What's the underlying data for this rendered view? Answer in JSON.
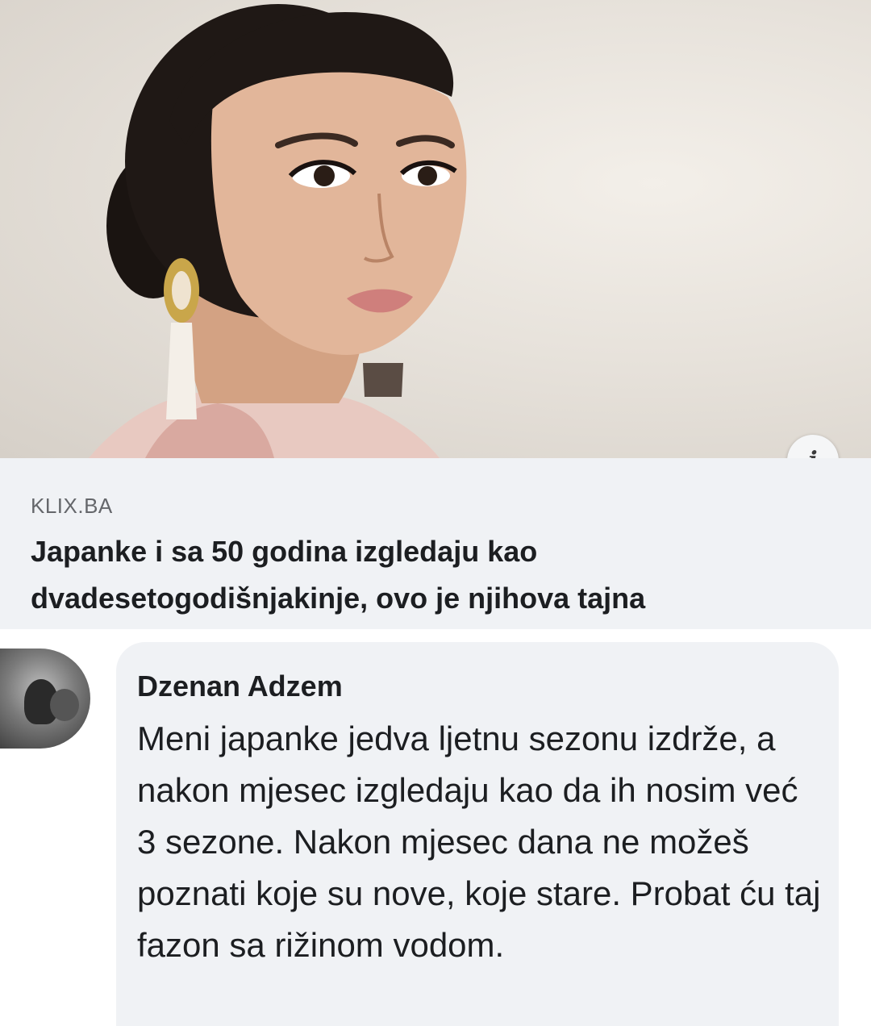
{
  "post": {
    "image_alt_icon": "portrait-photo",
    "info_label": "i"
  },
  "link_preview": {
    "source": "KLIX.BA",
    "headline": "Japanke i sa 50 godina izgledaju kao dvadesetogodišnjakinje, ovo je njihova tajna"
  },
  "comment": {
    "author": "Dzenan Adzem",
    "text": "Meni japanke jedva ljetnu sezonu izdrže, a nakon mjesec izgledaju kao da ih nosim već 3 sezone. Nakon mjesec dana ne možeš poznati koje su nove, koje stare. Probat ću taj fazon sa rižinom vodom."
  },
  "colors": {
    "preview_bg": "#f0f2f5",
    "text_primary": "#1c1e21",
    "text_secondary": "#65676b"
  }
}
